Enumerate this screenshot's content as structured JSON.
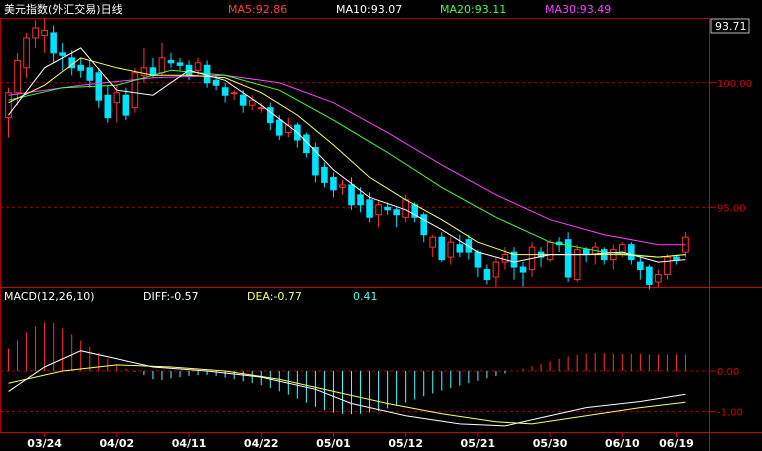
{
  "header": {
    "title": "美元指数(外汇交易)日线",
    "ma": [
      {
        "label": "MA5:92.86",
        "color": "#ff4040"
      },
      {
        "label": "MA10:93.07",
        "color": "#ffffff"
      },
      {
        "label": "MA20:93.11",
        "color": "#40ff40"
      },
      {
        "label": "MA30:93.49",
        "color": "#ff40ff"
      }
    ]
  },
  "macd_header": {
    "title": "MACD(12,26,10)",
    "diff": "DIFF:-0.57",
    "dea": "DEA:-0.77",
    "macd": "0.41"
  },
  "price_axis": {
    "current_tag": "93.71",
    "labels": [
      {
        "text": "100.00",
        "value": 100
      },
      {
        "text": "95.00",
        "value": 95
      }
    ]
  },
  "macd_axis": {
    "labels": [
      {
        "text": "0.00",
        "value": 0
      },
      {
        "text": "-1.00",
        "value": -1
      }
    ]
  },
  "date_axis": [
    "03/24",
    "04/02",
    "04/11",
    "04/22",
    "05/01",
    "05/12",
    "05/21",
    "05/30",
    "06/10",
    "06/19"
  ],
  "chart_data": {
    "type": "candlestick",
    "ylim": [
      91.8,
      102.6
    ],
    "macd_ylim": [
      -1.5,
      1.6
    ],
    "colors": {
      "up": "#ff3030",
      "down": "#00e0ff",
      "ma5": "#ffffff",
      "ma10": "#ffff66",
      "ma20": "#40ff40",
      "ma30": "#ff40ff",
      "diff": "#ffffff",
      "dea": "#ffff66"
    },
    "candles": [
      [
        98.6,
        99.6,
        97.8,
        99.8
      ],
      [
        99.6,
        100.9,
        99.1,
        101.2
      ],
      [
        100.6,
        101.8,
        100.2,
        102.0
      ],
      [
        101.8,
        102.2,
        101.4,
        102.5
      ],
      [
        101.9,
        102.1,
        101.2,
        102.6
      ],
      [
        102.0,
        101.2,
        100.8,
        102.3
      ],
      [
        101.2,
        101.1,
        100.5,
        101.6
      ],
      [
        101.0,
        100.6,
        100.3,
        101.3
      ],
      [
        100.7,
        100.5,
        100.2,
        101.0
      ],
      [
        100.6,
        100.1,
        99.8,
        100.9
      ],
      [
        100.4,
        99.3,
        99.0,
        100.6
      ],
      [
        99.5,
        98.6,
        98.4,
        99.9
      ],
      [
        99.2,
        99.6,
        98.4,
        99.9
      ],
      [
        99.5,
        98.7,
        98.5,
        99.8
      ],
      [
        99.0,
        100.4,
        98.8,
        100.6
      ],
      [
        100.3,
        100.6,
        100.0,
        101.4
      ],
      [
        100.6,
        100.3,
        100.2,
        101.0
      ],
      [
        100.4,
        101.0,
        100.3,
        101.6
      ],
      [
        100.9,
        100.8,
        100.6,
        101.2
      ],
      [
        100.8,
        100.7,
        100.5,
        101.0
      ],
      [
        100.7,
        100.3,
        100.1,
        100.9
      ],
      [
        100.5,
        100.8,
        100.3,
        101.0
      ],
      [
        100.7,
        100.0,
        99.8,
        100.9
      ],
      [
        100.1,
        99.9,
        99.7,
        100.3
      ],
      [
        99.8,
        99.5,
        99.2,
        100.0
      ],
      [
        99.6,
        99.6,
        99.3,
        99.7
      ],
      [
        99.5,
        99.1,
        98.8,
        99.7
      ],
      [
        99.1,
        99.3,
        98.9,
        99.5
      ],
      [
        99.0,
        99.0,
        98.8,
        99.2
      ],
      [
        99.0,
        98.4,
        98.1,
        99.2
      ],
      [
        98.5,
        97.9,
        97.7,
        98.7
      ],
      [
        98.0,
        98.3,
        97.8,
        98.6
      ],
      [
        98.3,
        97.7,
        97.4,
        98.4
      ],
      [
        97.9,
        97.2,
        97.0,
        98.0
      ],
      [
        97.4,
        96.3,
        96.0,
        97.6
      ],
      [
        96.6,
        96.0,
        95.8,
        96.8
      ],
      [
        96.2,
        95.7,
        95.4,
        96.4
      ],
      [
        95.8,
        95.9,
        95.5,
        96.1
      ],
      [
        95.9,
        95.1,
        94.9,
        96.2
      ],
      [
        95.5,
        95.1,
        94.8,
        95.8
      ],
      [
        95.3,
        94.6,
        94.4,
        95.6
      ],
      [
        94.7,
        95.1,
        94.2,
        95.3
      ],
      [
        95.0,
        94.9,
        94.7,
        95.2
      ],
      [
        94.9,
        94.7,
        94.2,
        95.0
      ],
      [
        94.6,
        95.3,
        94.4,
        95.5
      ],
      [
        95.1,
        94.6,
        94.4,
        95.2
      ],
      [
        94.7,
        93.9,
        93.6,
        94.8
      ],
      [
        93.4,
        93.8,
        93.0,
        93.9
      ],
      [
        93.8,
        92.9,
        92.8,
        94.0
      ],
      [
        93.0,
        93.6,
        92.7,
        93.8
      ],
      [
        93.5,
        93.2,
        93.0,
        93.9
      ],
      [
        93.7,
        93.2,
        92.9,
        93.9
      ],
      [
        93.2,
        92.6,
        92.2,
        93.3
      ],
      [
        92.5,
        92.1,
        91.9,
        92.7
      ],
      [
        92.2,
        92.8,
        91.8,
        93.0
      ],
      [
        92.8,
        93.1,
        92.5,
        93.4
      ],
      [
        93.2,
        92.6,
        92.1,
        93.4
      ],
      [
        92.6,
        92.4,
        91.8,
        92.8
      ],
      [
        92.5,
        93.4,
        92.2,
        93.6
      ],
      [
        93.2,
        93.0,
        92.6,
        93.4
      ],
      [
        92.9,
        93.6,
        92.8,
        93.7
      ],
      [
        93.6,
        93.5,
        93.2,
        93.8
      ],
      [
        93.7,
        92.2,
        92.0,
        94.0
      ],
      [
        92.1,
        93.3,
        92.0,
        93.5
      ],
      [
        93.3,
        93.1,
        92.8,
        93.4
      ],
      [
        93.1,
        93.4,
        92.7,
        93.6
      ],
      [
        93.3,
        92.9,
        92.7,
        93.4
      ],
      [
        92.9,
        93.3,
        92.5,
        93.5
      ],
      [
        93.2,
        93.5,
        93.0,
        93.6
      ],
      [
        93.5,
        92.9,
        92.7,
        93.6
      ],
      [
        92.8,
        92.5,
        92.1,
        93.0
      ],
      [
        92.6,
        91.9,
        91.7,
        92.7
      ],
      [
        92.0,
        92.3,
        91.8,
        92.5
      ],
      [
        92.3,
        93.0,
        92.1,
        93.1
      ],
      [
        93.0,
        92.9,
        92.7,
        93.1
      ],
      [
        93.2,
        93.8,
        93.0,
        94.0
      ]
    ],
    "ma_series": {
      "ma5": [
        [
          0,
          98.7
        ],
        [
          4,
          100.6
        ],
        [
          8,
          101.4
        ],
        [
          12,
          99.7
        ],
        [
          16,
          99.5
        ],
        [
          20,
          100.5
        ],
        [
          24,
          100.1
        ],
        [
          28,
          99.1
        ],
        [
          32,
          98.0
        ],
        [
          36,
          96.5
        ],
        [
          40,
          95.4
        ],
        [
          44,
          94.9
        ],
        [
          48,
          94.1
        ],
        [
          52,
          93.2
        ],
        [
          56,
          92.8
        ],
        [
          60,
          93.1
        ],
        [
          64,
          93.1
        ],
        [
          68,
          93.2
        ],
        [
          72,
          92.8
        ],
        [
          75,
          92.9
        ]
      ],
      "ma10": [
        [
          0,
          99.2
        ],
        [
          4,
          99.9
        ],
        [
          8,
          101.0
        ],
        [
          12,
          100.6
        ],
        [
          16,
          100.3
        ],
        [
          20,
          100.3
        ],
        [
          24,
          100.2
        ],
        [
          28,
          99.6
        ],
        [
          32,
          98.7
        ],
        [
          36,
          97.5
        ],
        [
          40,
          96.2
        ],
        [
          44,
          95.3
        ],
        [
          48,
          94.5
        ],
        [
          52,
          93.6
        ],
        [
          56,
          93.1
        ],
        [
          60,
          93.1
        ],
        [
          64,
          93.1
        ],
        [
          68,
          93.1
        ],
        [
          72,
          93.0
        ],
        [
          75,
          93.1
        ]
      ],
      "ma20": [
        [
          0,
          99.3
        ],
        [
          6,
          99.8
        ],
        [
          12,
          99.9
        ],
        [
          18,
          100.5
        ],
        [
          24,
          100.3
        ],
        [
          30,
          99.7
        ],
        [
          36,
          98.5
        ],
        [
          42,
          97.2
        ],
        [
          48,
          95.8
        ],
        [
          54,
          94.6
        ],
        [
          60,
          93.6
        ],
        [
          66,
          93.2
        ],
        [
          72,
          93.0
        ],
        [
          75,
          93.1
        ]
      ],
      "ma30": [
        [
          0,
          99.5
        ],
        [
          8,
          99.9
        ],
        [
          16,
          100.2
        ],
        [
          24,
          100.3
        ],
        [
          30,
          100.0
        ],
        [
          36,
          99.2
        ],
        [
          42,
          98.0
        ],
        [
          48,
          96.7
        ],
        [
          54,
          95.5
        ],
        [
          60,
          94.5
        ],
        [
          66,
          93.9
        ],
        [
          72,
          93.5
        ],
        [
          75,
          93.5
        ]
      ]
    },
    "macd_hist": [
      0.55,
      0.75,
      0.95,
      1.1,
      1.2,
      1.18,
      1.05,
      0.9,
      0.75,
      0.6,
      0.45,
      0.3,
      0.15,
      0.05,
      -0.02,
      -0.1,
      -0.2,
      -0.22,
      -0.18,
      -0.15,
      -0.12,
      -0.1,
      -0.1,
      -0.12,
      -0.16,
      -0.2,
      -0.25,
      -0.3,
      -0.35,
      -0.42,
      -0.5,
      -0.58,
      -0.68,
      -0.78,
      -0.88,
      -0.96,
      -1.02,
      -1.05,
      -1.06,
      -1.05,
      -1.02,
      -0.98,
      -0.92,
      -0.85,
      -0.78,
      -0.7,
      -0.62,
      -0.55,
      -0.48,
      -0.42,
      -0.36,
      -0.3,
      -0.24,
      -0.18,
      -0.12,
      -0.06,
      0.0,
      0.06,
      0.12,
      0.18,
      0.24,
      0.3,
      0.36,
      0.4,
      0.42,
      0.44,
      0.44,
      0.43,
      0.42,
      0.42,
      0.42,
      0.41,
      0.41,
      0.41,
      0.41,
      0.41
    ],
    "diff": [
      [
        0,
        -0.5
      ],
      [
        4,
        0.1
      ],
      [
        8,
        0.5
      ],
      [
        12,
        0.3
      ],
      [
        16,
        0.1
      ],
      [
        22,
        0.0
      ],
      [
        28,
        -0.15
      ],
      [
        34,
        -0.45
      ],
      [
        38,
        -0.8
      ],
      [
        44,
        -1.1
      ],
      [
        50,
        -1.3
      ],
      [
        55,
        -1.35
      ],
      [
        58,
        -1.2
      ],
      [
        64,
        -0.9
      ],
      [
        70,
        -0.75
      ],
      [
        75,
        -0.57
      ]
    ],
    "dea": [
      [
        0,
        -0.3
      ],
      [
        6,
        0.0
      ],
      [
        12,
        0.15
      ],
      [
        18,
        0.1
      ],
      [
        24,
        0.0
      ],
      [
        30,
        -0.2
      ],
      [
        36,
        -0.5
      ],
      [
        42,
        -0.8
      ],
      [
        48,
        -1.05
      ],
      [
        54,
        -1.25
      ],
      [
        58,
        -1.3
      ],
      [
        64,
        -1.1
      ],
      [
        70,
        -0.9
      ],
      [
        75,
        -0.77
      ]
    ]
  }
}
